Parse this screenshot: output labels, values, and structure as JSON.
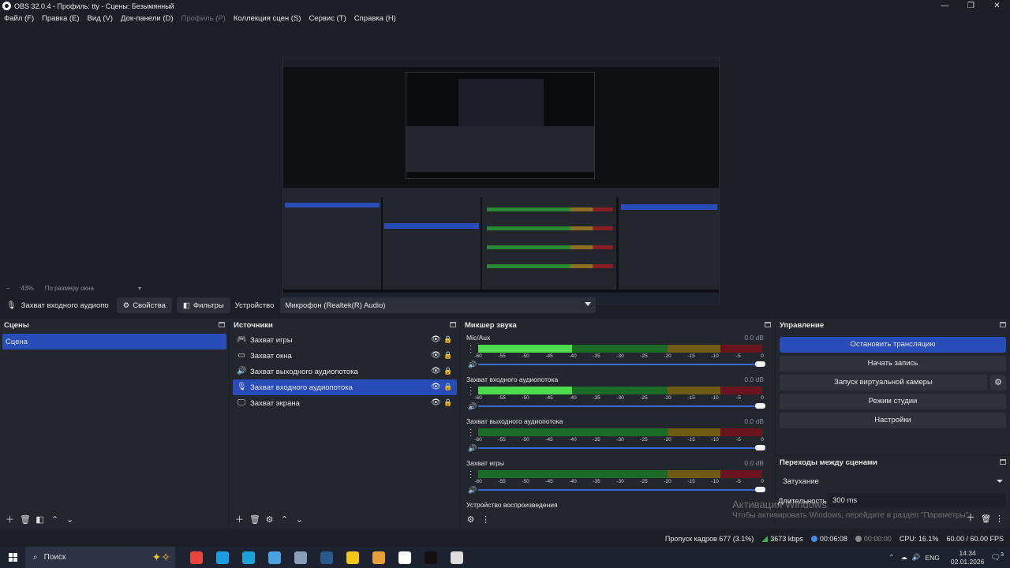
{
  "window": {
    "title": "OBS 32.0.4 - Профиль: tty - Сцены: Безымянный",
    "controls": [
      "—",
      "❐",
      "✕"
    ]
  },
  "menubar": [
    {
      "label": "Файл (F)",
      "disabled": false
    },
    {
      "label": "Правка (E)",
      "disabled": false
    },
    {
      "label": "Вид (V)",
      "disabled": false
    },
    {
      "label": "Док-панели (D)",
      "disabled": false
    },
    {
      "label": "Профиль (P)",
      "disabled": true
    },
    {
      "label": "Коллекция сцен (S)",
      "disabled": false
    },
    {
      "label": "Сервис (T)",
      "disabled": false
    },
    {
      "label": "Справка (H)",
      "disabled": false
    }
  ],
  "zoombar": {
    "minus": "−",
    "zoom": "43%",
    "fit": "По размеру окна"
  },
  "source_toolbar": {
    "source_name": "Захват входного аудиопо",
    "properties_label": "Свойства",
    "filters_label": "Фильтры",
    "device_label": "Устройство",
    "device_value": "Микрофон (Realtek(R) Audio)"
  },
  "scenes": {
    "title": "Сцены",
    "items": [
      {
        "label": "Сцена",
        "selected": true
      }
    ]
  },
  "sources": {
    "title": "Источники",
    "items": [
      {
        "label": "Захват игры",
        "icon": "gamepad-icon",
        "glyph": "🎮",
        "selected": false
      },
      {
        "label": "Захват окна",
        "icon": "window-icon",
        "glyph": "▭",
        "selected": false
      },
      {
        "label": "Захват выходного аудиопотока",
        "icon": "speaker-icon",
        "glyph": "🔊",
        "selected": false
      },
      {
        "label": "Захват входного аудиопотока",
        "icon": "microphone-icon",
        "glyph": "🎙",
        "selected": true
      },
      {
        "label": "Захват экрана",
        "icon": "monitor-icon",
        "glyph": "🖵",
        "selected": false
      }
    ]
  },
  "mixer": {
    "title": "Микшер звука",
    "ticks": [
      "-60",
      "-55",
      "-50",
      "-45",
      "-40",
      "-35",
      "-30",
      "-25",
      "-20",
      "-15",
      "-10",
      "-5",
      "0"
    ],
    "channels": [
      {
        "name": "Mic/Aux",
        "db": "0.0 dB",
        "level": 0.33
      },
      {
        "name": "Захват входного аудиопотока",
        "db": "0.0 dB",
        "level": 0.33
      },
      {
        "name": "Захват выходного аудиопотока",
        "db": "0.0 dB",
        "level": 0.0
      },
      {
        "name": "Захват игры",
        "db": "0.0 dB",
        "level": 0.0
      },
      {
        "name": "Устройство воспроизведения",
        "db": "",
        "level": 0.0
      }
    ]
  },
  "controls": {
    "title": "Управление",
    "stop_stream": "Остановить трансляцию",
    "start_record": "Начать запись",
    "virtual_cam": "Запуск виртуальной камеры",
    "studio_mode": "Режим студии",
    "settings": "Настройки"
  },
  "transitions": {
    "title": "Переходы между сценами",
    "type": "Затухание",
    "duration_label": "Длительность",
    "duration_value": "300 ms"
  },
  "activation": {
    "line1": "Активация Windows",
    "line2": "Чтобы активировать Windows, перейдите в раздел \"Параметры\"."
  },
  "statusbar": {
    "dropped": "Пропуск кадров 677 (3.1%)",
    "bitrate": "3673 kbps",
    "stream_time": "00:06:08",
    "rec_time": "00:00:00",
    "cpu": "CPU: 16.1%",
    "fps": "60.00 / 60.00 FPS"
  },
  "taskbar": {
    "search": "Поиск",
    "lang": "ENG",
    "time": "14:34",
    "date": "02.01.2026",
    "notifications": "3",
    "apps": [
      {
        "name": "cloud-app-icon",
        "color": "#e8453c"
      },
      {
        "name": "edge-icon",
        "color": "#1b9de2"
      },
      {
        "name": "app-icon",
        "color": "#1aa3d6"
      },
      {
        "name": "app-icon-2",
        "color": "#4aa3e0"
      },
      {
        "name": "app-icon-3",
        "color": "#8aa0b8"
      },
      {
        "name": "steam-icon",
        "color": "#2a5a88"
      },
      {
        "name": "app-icon-4",
        "color": "#f5c518"
      },
      {
        "name": "store-icon",
        "color": "#e8a03a"
      },
      {
        "name": "hl-icon",
        "color": "#ffffff"
      },
      {
        "name": "tiktok-icon",
        "color": "#111111"
      },
      {
        "name": "obs-icon",
        "color": "#dddddd"
      }
    ]
  },
  "colors": {
    "accent": "#284cb8",
    "panel": "#24262e",
    "bg": "#1d1f26"
  }
}
